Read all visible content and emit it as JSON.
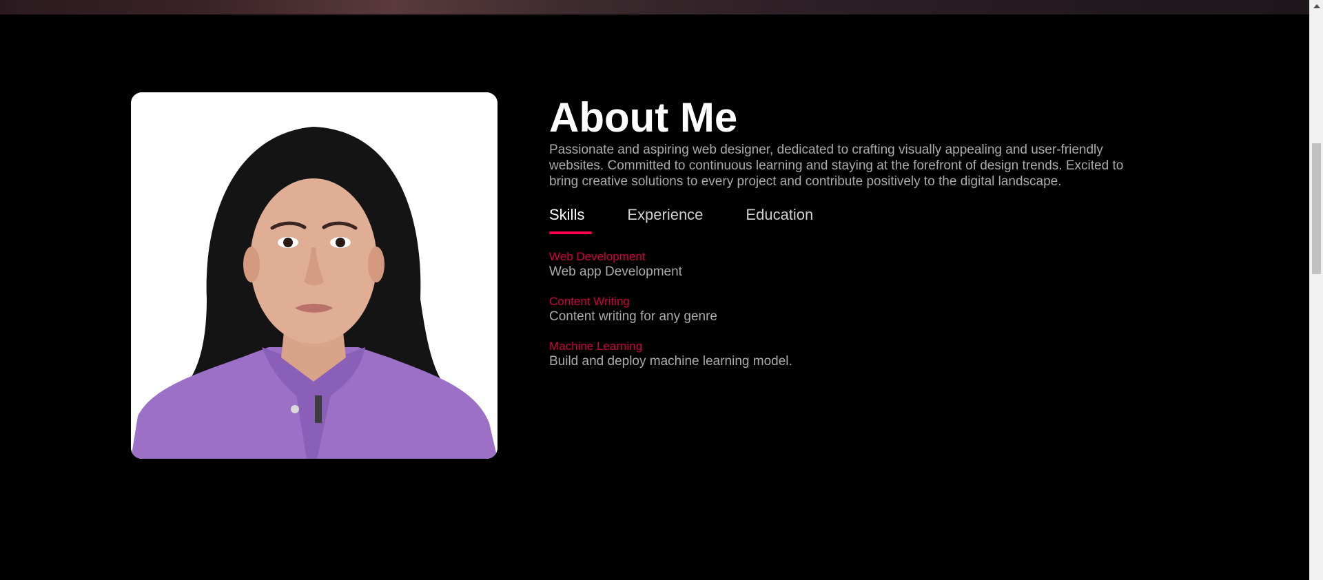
{
  "about": {
    "title": "About Me",
    "description": "Passionate and aspiring web designer, dedicated to crafting visually appealing and user-friendly websites. Committed to continuous learning and staying at the forefront of design trends. Excited to bring creative solutions to every project and contribute positively to the digital landscape.",
    "tabs": [
      {
        "label": "Skills",
        "active": true
      },
      {
        "label": "Experience",
        "active": false
      },
      {
        "label": "Education",
        "active": false
      }
    ],
    "skills": [
      {
        "title": "Web Development",
        "desc": "Web app Development"
      },
      {
        "title": "Content Writing",
        "desc": "Content writing for any genre"
      },
      {
        "title": "Machine Learning",
        "desc": "Build and deploy machine learning model."
      }
    ]
  },
  "colors": {
    "accent": "#ff004f",
    "background": "#000000",
    "text_muted": "#ababab",
    "heading": "#ffffff"
  },
  "icons": {
    "scroll_up": "triangle-up"
  }
}
